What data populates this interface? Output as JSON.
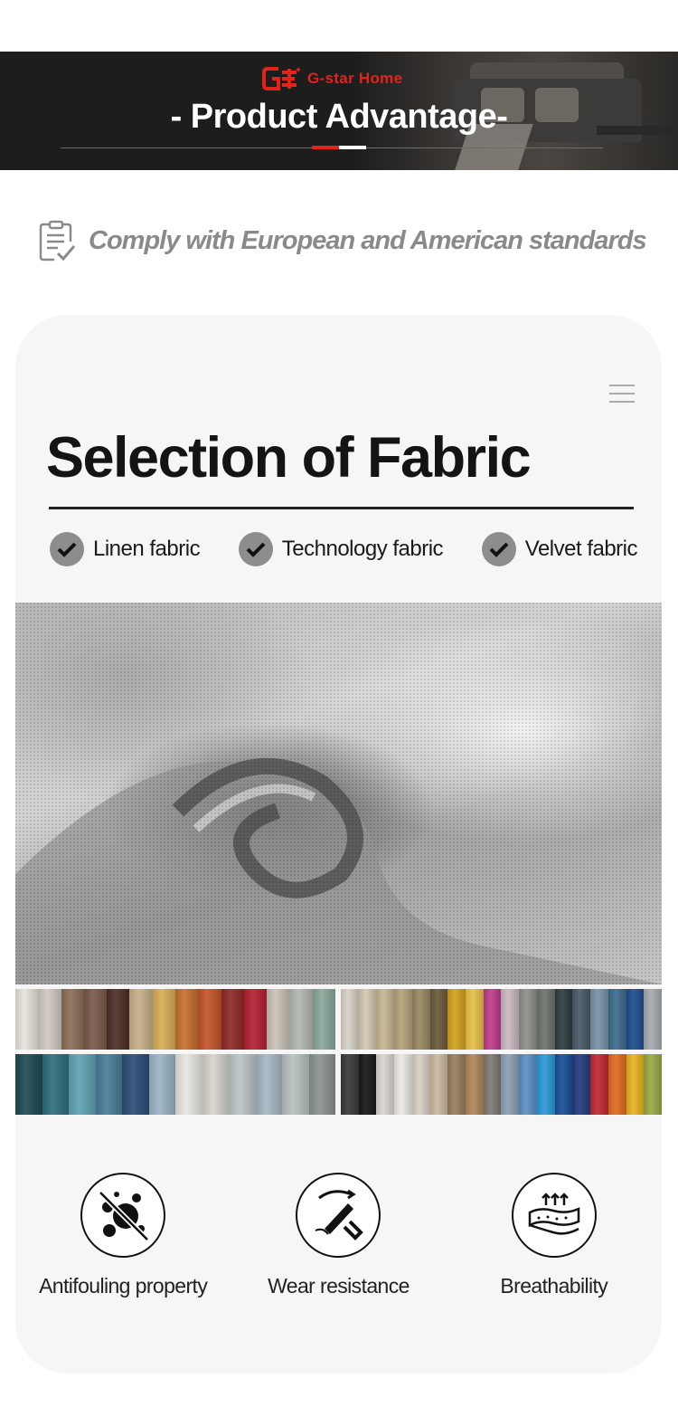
{
  "header": {
    "brand": "G-star Home",
    "title": "- Product Advantage-",
    "accent_red": "#e2231a"
  },
  "standards": {
    "icon": "document-check-icon",
    "text": "Comply with European and American standards"
  },
  "card": {
    "menu_icon": "menu-icon",
    "title": "Selection of Fabric",
    "fabric_types": [
      {
        "label": "Linen fabric",
        "icon": "check-icon"
      },
      {
        "label": "Technology fabric",
        "icon": "check-icon"
      },
      {
        "label": "Velvet fabric",
        "icon": "check-icon"
      }
    ],
    "swatch_rows": [
      {
        "left": [
          "#e7e3db",
          "#cfc9c0",
          "#8c6e5a",
          "#7a5a4a",
          "#4e2f28",
          "#c7b08a",
          "#d9ad57",
          "#c6702f",
          "#c4552c",
          "#8e2a28",
          "#b52032",
          "#c9c3b8",
          "#b2b8b2",
          "#8aa79b"
        ],
        "right": [
          "#d8d2c6",
          "#d4c9b2",
          "#c8b695",
          "#b7a27c",
          "#9a8763",
          "#6b5b3c",
          "#d3a21b",
          "#e6c04a",
          "#c03b8a",
          "#c9b9c0",
          "#8d8f89",
          "#6f7470",
          "#2e3d40",
          "#4a5a66",
          "#7793a7",
          "#3d6b8c",
          "#1e4f8e",
          "#a7aab0"
        ]
      },
      {
        "left": [
          "#1e4b55",
          "#2f6f7d",
          "#5fa3b5",
          "#4a7d99",
          "#2c4c76",
          "#9ab4c6",
          "#e7e5df",
          "#d6d4cb",
          "#bcc5c7",
          "#a6b8c3",
          "#b8c1c1",
          "#8c948f"
        ],
        "right": [
          "#3a3a3a",
          "#181818",
          "#d9d6d1",
          "#ece9e3",
          "#d8cfc1",
          "#cbb9a1",
          "#9a7e5f",
          "#b0875a",
          "#7d7972",
          "#8ca0b4",
          "#5d8fc4",
          "#2c98d8",
          "#1a4f97",
          "#243a7e",
          "#c02731",
          "#e06b1f",
          "#e7b31f",
          "#9aa844"
        ]
      }
    ],
    "features": [
      {
        "label": "Antifouling property",
        "icon": "antifouling-icon"
      },
      {
        "label": "Wear resistance",
        "icon": "wear-resistance-icon"
      },
      {
        "label": "Breathability",
        "icon": "breathability-icon"
      }
    ]
  }
}
